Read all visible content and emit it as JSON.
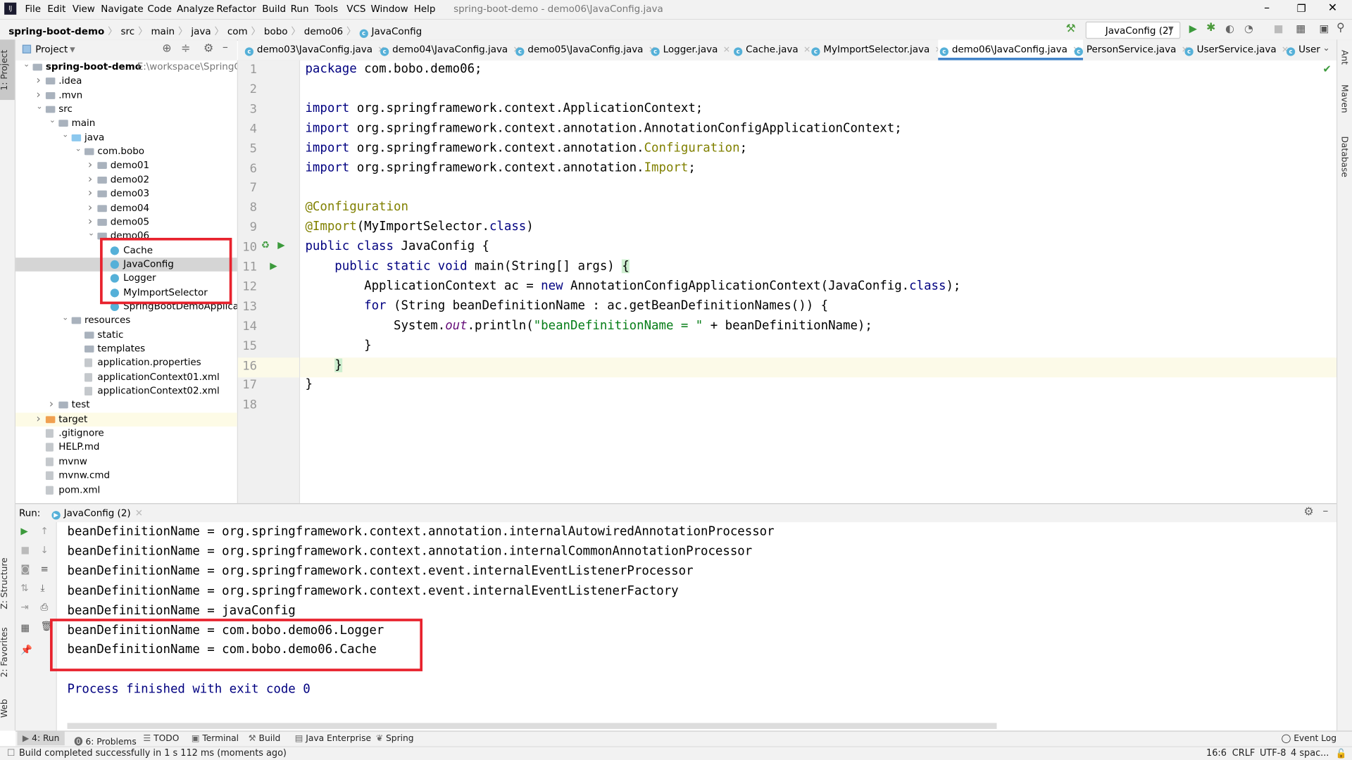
{
  "app": {
    "title": "spring-boot-demo - demo06\\JavaConfig.java",
    "logo": "IJ"
  },
  "menu": [
    "File",
    "Edit",
    "View",
    "Navigate",
    "Code",
    "Analyze",
    "Refactor",
    "Build",
    "Run",
    "Tools",
    "VCS",
    "Window",
    "Help"
  ],
  "breadcrumb": [
    "spring-boot-demo",
    "src",
    "main",
    "java",
    "com",
    "bobo",
    "demo06",
    "JavaConfig"
  ],
  "run_config": "JavaConfig (2)",
  "left_stripe": {
    "project": "1: Project",
    "structure": "Z: Structure",
    "favorites": "2: Favorites",
    "web": "Web"
  },
  "right_stripe": [
    "Ant",
    "Maven",
    "Database"
  ],
  "project_panel": {
    "title": "Project",
    "root_path": "E:\\workspace\\SpringCloud"
  },
  "tree": [
    {
      "label": "spring-boot-demo",
      "d": 0,
      "arrow": "open",
      "icon": "module",
      "bold": true
    },
    {
      "label": ".idea",
      "d": 1,
      "arrow": "closed",
      "icon": "folder"
    },
    {
      "label": ".mvn",
      "d": 1,
      "arrow": "closed",
      "icon": "folder"
    },
    {
      "label": "src",
      "d": 1,
      "arrow": "open",
      "icon": "folder"
    },
    {
      "label": "main",
      "d": 2,
      "arrow": "open",
      "icon": "folder"
    },
    {
      "label": "java",
      "d": 3,
      "arrow": "open",
      "icon": "source-folder"
    },
    {
      "label": "com.bobo",
      "d": 4,
      "arrow": "open",
      "icon": "package"
    },
    {
      "label": "demo01",
      "d": 5,
      "arrow": "closed",
      "icon": "package"
    },
    {
      "label": "demo02",
      "d": 5,
      "arrow": "closed",
      "icon": "package"
    },
    {
      "label": "demo03",
      "d": 5,
      "arrow": "closed",
      "icon": "package"
    },
    {
      "label": "demo04",
      "d": 5,
      "arrow": "closed",
      "icon": "package"
    },
    {
      "label": "demo05",
      "d": 5,
      "arrow": "closed",
      "icon": "package"
    },
    {
      "label": "demo06",
      "d": 5,
      "arrow": "open",
      "icon": "package"
    },
    {
      "label": "Cache",
      "d": 6,
      "icon": "class"
    },
    {
      "label": "JavaConfig",
      "d": 6,
      "icon": "class",
      "selected": true
    },
    {
      "label": "Logger",
      "d": 6,
      "icon": "class"
    },
    {
      "label": "MyImportSelector",
      "d": 6,
      "icon": "class"
    },
    {
      "label": "SpringBootDemoApplication",
      "d": 6,
      "icon": "class"
    },
    {
      "label": "resources",
      "d": 3,
      "arrow": "open",
      "icon": "folder"
    },
    {
      "label": "static",
      "d": 4,
      "icon": "folder"
    },
    {
      "label": "templates",
      "d": 4,
      "icon": "folder"
    },
    {
      "label": "application.properties",
      "d": 4,
      "icon": "file"
    },
    {
      "label": "applicationContext01.xml",
      "d": 4,
      "icon": "file"
    },
    {
      "label": "applicationContext02.xml",
      "d": 4,
      "icon": "file"
    },
    {
      "label": "test",
      "d": 2,
      "arrow": "closed",
      "icon": "folder"
    },
    {
      "label": "target",
      "d": 1,
      "arrow": "closed",
      "icon": "excluded-folder",
      "highlight": true
    },
    {
      "label": ".gitignore",
      "d": 1,
      "icon": "file"
    },
    {
      "label": "HELP.md",
      "d": 1,
      "icon": "file"
    },
    {
      "label": "mvnw",
      "d": 1,
      "icon": "file"
    },
    {
      "label": "mvnw.cmd",
      "d": 1,
      "icon": "file"
    },
    {
      "label": "pom.xml",
      "d": 1,
      "icon": "file"
    }
  ],
  "tabs": [
    {
      "label": "demo03\\JavaConfig.java"
    },
    {
      "label": "demo04\\JavaConfig.java"
    },
    {
      "label": "demo05\\JavaConfig.java"
    },
    {
      "label": "Logger.java"
    },
    {
      "label": "Cache.java"
    },
    {
      "label": "MyImportSelector.java"
    },
    {
      "label": "demo06\\JavaConfig.java",
      "active": true
    },
    {
      "label": "PersonService.java"
    },
    {
      "label": "UserService.java"
    },
    {
      "label": "User"
    }
  ],
  "code": [
    [
      [
        "package ",
        "k"
      ],
      [
        "com.bobo.demo06;",
        ""
      ]
    ],
    [],
    [
      [
        "import ",
        "k"
      ],
      [
        "org.springframework.context.ApplicationContext;",
        ""
      ]
    ],
    [
      [
        "import ",
        "k"
      ],
      [
        "org.springframework.context.annotation.AnnotationConfigApplicationContext;",
        ""
      ]
    ],
    [
      [
        "import ",
        "k"
      ],
      [
        "org.springframework.context.annotation.",
        ""
      ],
      [
        "Configuration",
        "a"
      ],
      [
        ";",
        ""
      ]
    ],
    [
      [
        "import ",
        "k"
      ],
      [
        "org.springframework.context.annotation.",
        ""
      ],
      [
        "Import",
        "a"
      ],
      [
        ";",
        ""
      ]
    ],
    [],
    [
      [
        "@Configuration",
        "a"
      ]
    ],
    [
      [
        "@Import",
        "a"
      ],
      [
        "(MyImportSelector.",
        ""
      ],
      [
        "class",
        "k"
      ],
      [
        ")",
        ""
      ]
    ],
    [
      [
        "public class ",
        "k"
      ],
      [
        "JavaConfig {",
        ""
      ]
    ],
    [
      [
        "    public static void ",
        "k"
      ],
      [
        "main(String[] args) ",
        ""
      ],
      [
        "{",
        "b"
      ]
    ],
    [
      [
        "        ApplicationContext ac = ",
        ""
      ],
      [
        "new ",
        "k"
      ],
      [
        "AnnotationConfigApplicationContext(JavaConfig.",
        ""
      ],
      [
        "class",
        "k"
      ],
      [
        ");",
        ""
      ]
    ],
    [
      [
        "        for ",
        "k"
      ],
      [
        "(String beanDefinitionName : ac.getBeanDefinitionNames()) {",
        ""
      ]
    ],
    [
      [
        "            System.",
        ""
      ],
      [
        "out",
        "o"
      ],
      [
        ".println(",
        ""
      ],
      [
        "\"beanDefinitionName = \"",
        "s"
      ],
      [
        " + beanDefinitionName);",
        ""
      ]
    ],
    [
      [
        "        }",
        ""
      ]
    ],
    [
      [
        "    ",
        ""
      ],
      [
        "}",
        "b"
      ]
    ],
    [
      [
        "}",
        ""
      ]
    ],
    []
  ],
  "current_line": 16,
  "run_panel": {
    "label": "Run:",
    "tab": "JavaConfig (2)"
  },
  "console": [
    "beanDefinitionName = org.springframework.context.annotation.internalAutowiredAnnotationProcessor",
    "beanDefinitionName = org.springframework.context.annotation.internalCommonAnnotationProcessor",
    "beanDefinitionName = org.springframework.context.event.internalEventListenerProcessor",
    "beanDefinitionName = org.springframework.context.event.internalEventListenerFactory",
    "beanDefinitionName = javaConfig",
    "beanDefinitionName = com.bobo.demo06.Logger",
    "beanDefinitionName = com.bobo.demo06.Cache",
    "",
    "Process finished with exit code 0"
  ],
  "bottom_tools": [
    "4: Run",
    "6: Problems",
    "TODO",
    "Terminal",
    "Build",
    "Java Enterprise",
    "Spring"
  ],
  "event_log": "Event Log",
  "status": {
    "message": "Build completed successfully in 1 s 112 ms (moments ago)",
    "position": "16:6",
    "line_sep": "CRLF",
    "encoding": "UTF-8",
    "indent": "4 spac..."
  },
  "colors": {
    "highlight_box": "#e8222d",
    "active_tab": "#4083c9",
    "keyword": "#000080",
    "annotation": "#808000",
    "string": "#067d17"
  }
}
